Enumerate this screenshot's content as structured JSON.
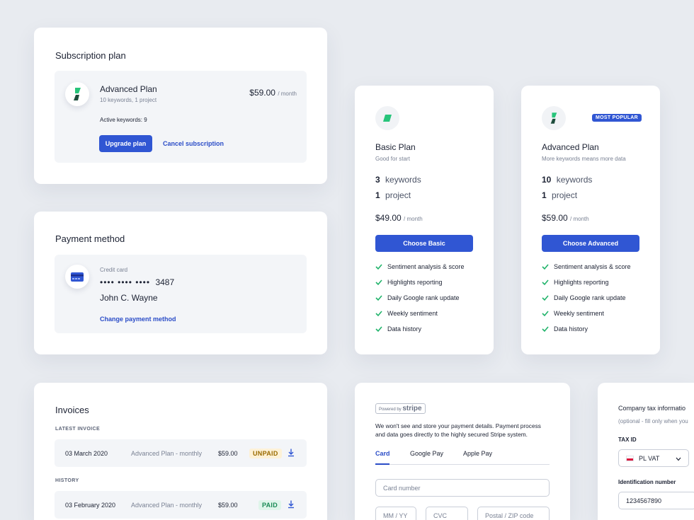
{
  "subscription": {
    "title": "Subscription plan",
    "plan_name": "Advanced Plan",
    "plan_details": "10 keywords, 1 project",
    "price": "$59.00",
    "per": "/ month",
    "active_keywords": "Active keywords: 9",
    "upgrade_label": "Upgrade plan",
    "cancel_label": "Cancel subscription"
  },
  "payment": {
    "title": "Payment method",
    "type_label": "Credit card",
    "masked": "•••• •••• ••••",
    "last4": "3487",
    "holder": "John C. Wayne",
    "change_label": "Change payment method"
  },
  "plans": [
    {
      "name": "Basic Plan",
      "tagline": "Good for start",
      "keywords_num": "3",
      "keywords_label": "keywords",
      "projects_num": "1",
      "projects_label": "project",
      "price": "$49.00",
      "per": "/ month",
      "button": "Choose Basic",
      "features": [
        "Sentiment analysis & score",
        "Highlights reporting",
        "Daily Google rank update",
        "Weekly sentiment",
        "Data history"
      ]
    },
    {
      "name": "Advanced Plan",
      "tagline": "More keywords means more data",
      "badge": "MOST POPULAR",
      "keywords_num": "10",
      "keywords_label": "keywords",
      "projects_num": "1",
      "projects_label": "project",
      "price": "$59.00",
      "per": "/ month",
      "button": "Choose Advanced",
      "features": [
        "Sentiment analysis & score",
        "Highlights reporting",
        "Daily Google rank update",
        "Weekly sentiment",
        "Data history"
      ]
    }
  ],
  "invoices": {
    "title": "Invoices",
    "latest_label": "LATEST INVOICE",
    "history_label": "HISTORY",
    "latest": {
      "date": "03 March 2020",
      "plan": "Advanced Plan - monthly",
      "amount": "$59.00",
      "status": "UNPAID"
    },
    "history": [
      {
        "date": "03 February 2020",
        "plan": "Advanced Plan - monthly",
        "amount": "$59.00",
        "status": "PAID"
      }
    ]
  },
  "stripe": {
    "powered_by": "Powered by",
    "brand": "stripe",
    "notice": [
      "We won't see and store your payment details. Payment process",
      "and data goes directly to the highly secured Stripe system."
    ],
    "tabs": [
      "Card",
      "Google Pay",
      "Apple Pay"
    ],
    "card_number_placeholder": "Card number",
    "expiry_placeholder": "MM / YY",
    "cvc_placeholder": "CVC",
    "postal_placeholder": "Postal / ZIP code"
  },
  "tax": {
    "title": "Company tax informatio",
    "subtitle": "(optional - fill only when you",
    "tax_id_label": "TAX ID",
    "tax_id_value": "PL VAT",
    "ident_label": "Identification number",
    "ident_value": "1234567890"
  },
  "colors": {
    "accent": "#3056d3",
    "brand_green": "#27c47a",
    "check_green": "#20b36a",
    "unpaid_bg": "#fdf1d6",
    "paid_bg": "#dff5ea"
  }
}
